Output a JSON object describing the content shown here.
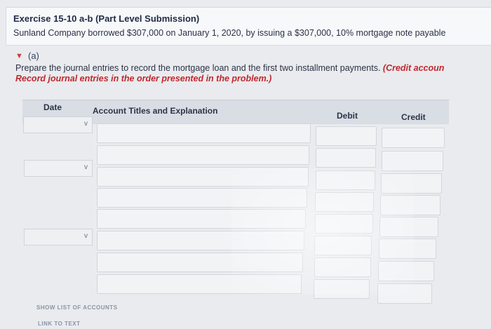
{
  "exercise": {
    "title": "Exercise 15-10 a-b (Part Level Submission)",
    "description": "Sunland Company borrowed $307,000 on January 1, 2020, by issuing a $307,000, 10% mortgage note payable"
  },
  "part": {
    "label": "(a)",
    "instruction": "Prepare the journal entries to record the mortgage loan and the first two installment payments.",
    "instruction_emphasis": "(Credit accoun",
    "instruction_line2": "Record journal entries in the order presented in the problem.)"
  },
  "table": {
    "headers": {
      "date": "Date",
      "account": "Account Titles and Explanation",
      "debit": "Debit",
      "credit": "Credit"
    }
  },
  "links": {
    "show_accounts": "SHOW LIST OF ACCOUNTS",
    "link_to_text": "LINK TO TEXT"
  },
  "icons": {
    "chevron": "chevron-down-icon",
    "toggle": "triangle-down-icon"
  },
  "colors": {
    "accent_red": "#c1272d"
  }
}
